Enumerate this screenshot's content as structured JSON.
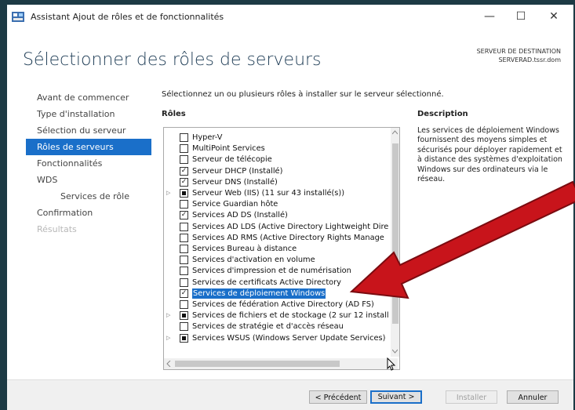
{
  "window": {
    "title": "Assistant Ajout de rôles et de fonctionnalités",
    "min_glyph": "—",
    "max_glyph": "☐",
    "close_glyph": "✕"
  },
  "header": {
    "page_title": "Sélectionner des rôles de serveurs",
    "dest_label": "SERVEUR DE DESTINATION",
    "dest_server": "SERVERAD.tssr.dom"
  },
  "nav": [
    {
      "label": "Avant de commencer",
      "state": "normal",
      "sub": false
    },
    {
      "label": "Type d'installation",
      "state": "normal",
      "sub": false
    },
    {
      "label": "Sélection du serveur",
      "state": "normal",
      "sub": false
    },
    {
      "label": "Rôles de serveurs",
      "state": "selected",
      "sub": false
    },
    {
      "label": "Fonctionnalités",
      "state": "normal",
      "sub": false
    },
    {
      "label": "WDS",
      "state": "normal",
      "sub": false
    },
    {
      "label": "Services de rôle",
      "state": "normal",
      "sub": true
    },
    {
      "label": "Confirmation",
      "state": "normal",
      "sub": false
    },
    {
      "label": "Résultats",
      "state": "disabled",
      "sub": false
    }
  ],
  "main": {
    "instruction": "Sélectionnez un ou plusieurs rôles à installer sur le serveur sélectionné.",
    "roles_header": "Rôles",
    "description_header": "Description",
    "description_text": "Les services de déploiement Windows fournissent des moyens simples et sécurisés pour déployer rapidement et à distance des systèmes d'exploitation Windows sur des ordinateurs via le réseau."
  },
  "roles": [
    {
      "label": "Hyper-V",
      "state": "unchecked",
      "expand": false,
      "highlight": false
    },
    {
      "label": "MultiPoint Services",
      "state": "unchecked",
      "expand": false,
      "highlight": false
    },
    {
      "label": "Serveur de télécopie",
      "state": "unchecked",
      "expand": false,
      "highlight": false
    },
    {
      "label": "Serveur DHCP (Installé)",
      "state": "checked",
      "expand": false,
      "highlight": false
    },
    {
      "label": "Serveur DNS (Installé)",
      "state": "checked",
      "expand": false,
      "highlight": false
    },
    {
      "label": "Serveur Web (IIS) (11 sur 43 installé(s))",
      "state": "partial",
      "expand": true,
      "highlight": false
    },
    {
      "label": "Service Guardian hôte",
      "state": "unchecked",
      "expand": false,
      "highlight": false
    },
    {
      "label": "Services AD DS (Installé)",
      "state": "checked",
      "expand": false,
      "highlight": false
    },
    {
      "label": "Services AD LDS (Active Directory Lightweight Dire",
      "state": "unchecked",
      "expand": false,
      "highlight": false
    },
    {
      "label": "Services AD RMS (Active Directory Rights Manage",
      "state": "unchecked",
      "expand": false,
      "highlight": false
    },
    {
      "label": "Services Bureau à distance",
      "state": "unchecked",
      "expand": false,
      "highlight": false
    },
    {
      "label": "Services d'activation en volume",
      "state": "unchecked",
      "expand": false,
      "highlight": false
    },
    {
      "label": "Services d'impression et de numérisation",
      "state": "unchecked",
      "expand": false,
      "highlight": false
    },
    {
      "label": "Services de certificats Active Directory",
      "state": "unchecked",
      "expand": false,
      "highlight": false
    },
    {
      "label": "Services de déploiement Windows",
      "state": "checked",
      "expand": false,
      "highlight": true
    },
    {
      "label": "Services de fédération Active Directory (AD FS)",
      "state": "unchecked",
      "expand": false,
      "highlight": false
    },
    {
      "label": "Services de fichiers et de stockage (2 sur 12 install",
      "state": "partial",
      "expand": true,
      "highlight": false
    },
    {
      "label": "Services de stratégie et d'accès réseau",
      "state": "unchecked",
      "expand": false,
      "highlight": false
    },
    {
      "label": "Services WSUS (Windows Server Update Services)",
      "state": "partial",
      "expand": true,
      "highlight": false
    }
  ],
  "footer": {
    "prev_label": "< Précédent",
    "next_label": "Suivant >",
    "install_label": "Installer",
    "cancel_label": "Annuler"
  },
  "colors": {
    "accent": "#1a6fc9",
    "arrow": "#c8141b"
  }
}
